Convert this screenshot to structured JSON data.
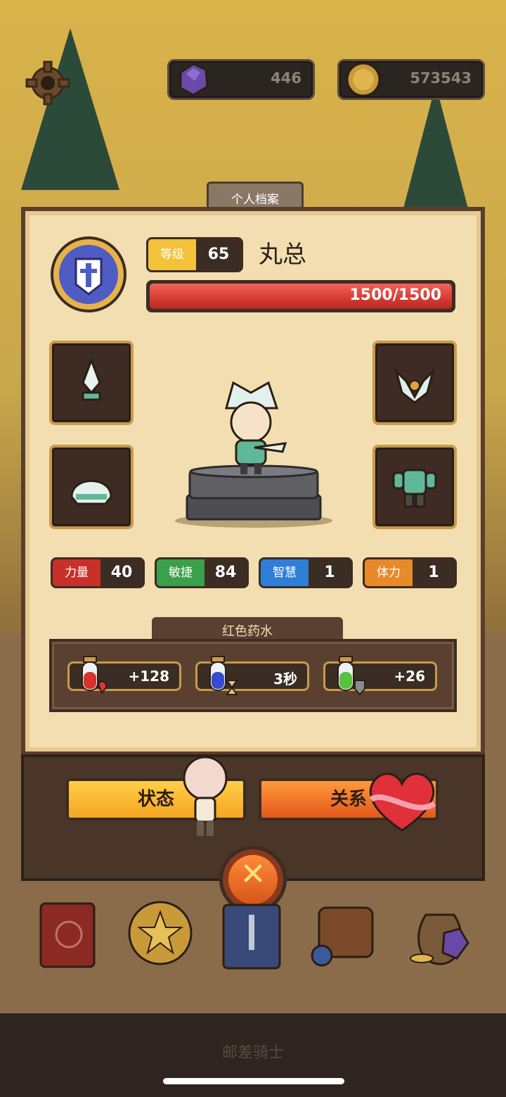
{
  "currency": {
    "gems": "446",
    "coins": "573543"
  },
  "panel": {
    "tab_label": "个人档案",
    "level_label": "等级",
    "level_value": "65",
    "player_name": "丸总",
    "hp_text": "1500/1500",
    "hp_fraction": 1.0
  },
  "stats": [
    {
      "label": "力量",
      "value": "40",
      "color": "#c8302a"
    },
    {
      "label": "敏捷",
      "value": "84",
      "color": "#3aa04a"
    },
    {
      "label": "智慧",
      "value": "1",
      "color": "#2f7fd8"
    },
    {
      "label": "体力",
      "value": "1",
      "color": "#e8892a"
    }
  ],
  "potion": {
    "title": "红色药水",
    "items": [
      {
        "icon": "red-potion-heart-icon",
        "value": "+128"
      },
      {
        "icon": "blue-potion-hourglass-icon",
        "value": "3秒"
      },
      {
        "icon": "green-potion-shield-icon",
        "value": "+26"
      }
    ]
  },
  "buttons": {
    "status": "状态",
    "relation": "关系"
  },
  "bottom_title": "邮差骑士",
  "nav_icons": [
    "book-icon",
    "coin-star-icon",
    "card-sword-icon",
    "backpack-icon",
    "treasure-bag-icon"
  ],
  "colors": {
    "hp_bar": "#d63a32",
    "status_button": "#f5a623",
    "relation_button": "#e4571b",
    "panel_bg": "#f2deb0"
  }
}
